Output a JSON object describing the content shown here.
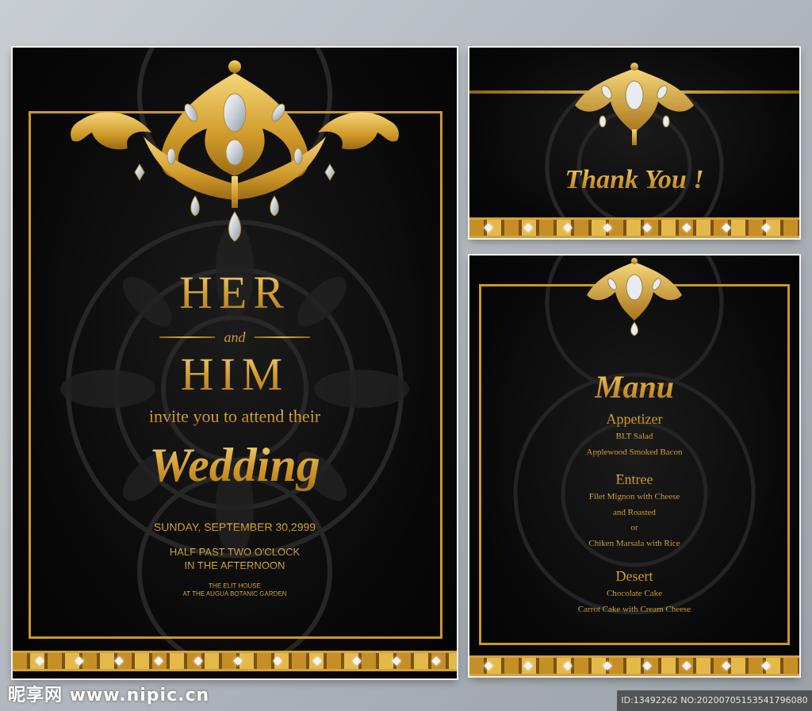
{
  "invitation": {
    "name_1": "HER",
    "connector": "and",
    "name_2": "HIM",
    "invite_line": "invite you to attend their",
    "event": "Wedding",
    "date": "SUNDAY, SEPTEMBER 30,2999",
    "time_line_1": "HALF PAST TWO O'CLOCK",
    "time_line_2": "IN THE AFTERNOON",
    "venue_line_1": "THE ELIT HOUSE",
    "venue_line_2": "AT THE AUGUA BOTANIC GARDEN"
  },
  "thank_you": {
    "text": "Thank You !"
  },
  "menu": {
    "title": "Manu",
    "sections": [
      {
        "heading": "Appetizer",
        "items": [
          "BLT Salad",
          "Applewood Smoked Bacon"
        ]
      },
      {
        "heading": "Entree",
        "items": [
          "Filet Mignon with Cheese",
          "and Roasted",
          "or",
          "Chiken Marsala with Rice"
        ]
      },
      {
        "heading": "Desert",
        "items": [
          "Chocolate Cake",
          "Carrot Cake with Cream Cheese"
        ]
      }
    ]
  },
  "watermark": {
    "left": "昵享网 www.nipic.cn",
    "right": "ID:13492262 NO:20200705153541796080"
  },
  "colors": {
    "gold": "#d9a83c",
    "card_background": "#0a0a0a",
    "gem": "#f0f3f7"
  },
  "icons": [
    "jeweled-crown-ornament",
    "damask-pattern",
    "gold-band-border"
  ]
}
